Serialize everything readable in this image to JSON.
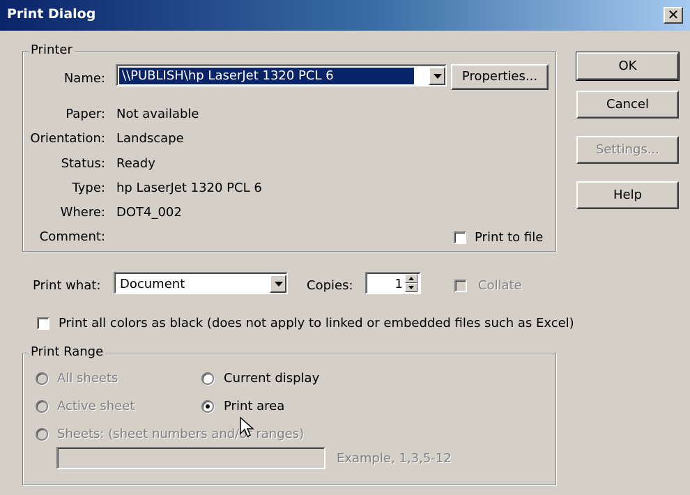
{
  "window": {
    "title": "Print Dialog",
    "close_symbol": "✕"
  },
  "printer": {
    "group_label": "Printer",
    "name_label": "Name:",
    "name_value": "\\\\PUBLISH\\hp LaserJet 1320 PCL 6",
    "properties_button": "Properties...",
    "paper_label": "Paper:",
    "paper_value": "Not available",
    "orientation_label": "Orientation:",
    "orientation_value": "Landscape",
    "status_label": "Status:",
    "status_value": "Ready",
    "type_label": "Type:",
    "type_value": "hp LaserJet 1320 PCL 6",
    "where_label": "Where:",
    "where_value": "DOT4_002",
    "comment_label": "Comment:",
    "print_to_file_label": "Print to file",
    "print_to_file_checked": false
  },
  "side_buttons": {
    "ok": "OK",
    "cancel": "Cancel",
    "settings": "Settings...",
    "help": "Help"
  },
  "options": {
    "print_what_label": "Print what:",
    "print_what_value": "Document",
    "copies_label": "Copies:",
    "copies_value": "1",
    "collate_label": "Collate",
    "black_label": "Print all colors as black (does not apply to linked or embedded files such as Excel)"
  },
  "range": {
    "group_label": "Print Range",
    "all_sheets": "All sheets",
    "current_display": "Current display",
    "active_sheet": "Active sheet",
    "print_area": "Print area",
    "sheets": "Sheets: (sheet numbers and/or ranges)",
    "example": "Example, 1,3,5-12",
    "selected": "print_area"
  }
}
